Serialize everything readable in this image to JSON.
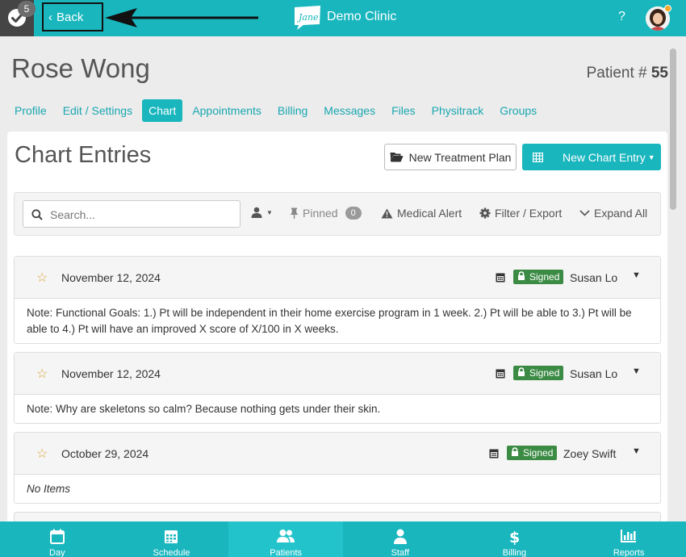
{
  "topbar": {
    "notification_count": "5",
    "back_label": "Back",
    "logo_text": "Jane",
    "clinic_name": "Demo Clinic",
    "help_label": "?"
  },
  "patient": {
    "name": "Rose Wong",
    "number_prefix": "Patient #",
    "number": "55"
  },
  "tabs": [
    {
      "label": "Profile",
      "active": false
    },
    {
      "label": "Edit / Settings",
      "active": false
    },
    {
      "label": "Chart",
      "active": true
    },
    {
      "label": "Appointments",
      "active": false
    },
    {
      "label": "Billing",
      "active": false
    },
    {
      "label": "Messages",
      "active": false
    },
    {
      "label": "Files",
      "active": false
    },
    {
      "label": "Physitrack",
      "active": false
    },
    {
      "label": "Groups",
      "active": false
    }
  ],
  "chart": {
    "title": "Chart Entries",
    "new_treatment_plan_label": "New Treatment Plan",
    "new_chart_entry_label": "New Chart Entry"
  },
  "toolbar": {
    "search_placeholder": "Search...",
    "pinned_label": "Pinned",
    "pinned_count": "0",
    "medical_alert_label": "Medical Alert",
    "filter_export_label": "Filter / Export",
    "expand_all_label": "Expand All"
  },
  "entries": [
    {
      "date": "November 12, 2024",
      "status": "Signed",
      "author": "Susan Lo",
      "body": "Note: Functional Goals: 1.) Pt will be independent in their home exercise program in 1 week. 2.) Pt will be able to 3.) Pt will be able to 4.) Pt will have an improved X score of X/100 in X weeks."
    },
    {
      "date": "November 12, 2024",
      "status": "Signed",
      "author": "Susan Lo",
      "body": "Note: Why are skeletons so calm? Because nothing gets under their skin."
    },
    {
      "date": "October 29, 2024",
      "status": "Signed",
      "author": "Zoey Swift",
      "body": "No Items"
    }
  ],
  "bottom_nav": [
    {
      "label": "Day",
      "icon": "calendar-icon",
      "active": false
    },
    {
      "label": "Schedule",
      "icon": "schedule-grid-icon",
      "active": false
    },
    {
      "label": "Patients",
      "icon": "patients-icon",
      "active": true
    },
    {
      "label": "Staff",
      "icon": "staff-icon",
      "active": false
    },
    {
      "label": "Billing",
      "icon": "dollar-icon",
      "active": false
    },
    {
      "label": "Reports",
      "icon": "bar-chart-icon",
      "active": false
    }
  ],
  "colors": {
    "brand": "#19b6be",
    "signed": "#3c8b45",
    "star": "#d9a53a",
    "notification_bg": "#454545"
  }
}
